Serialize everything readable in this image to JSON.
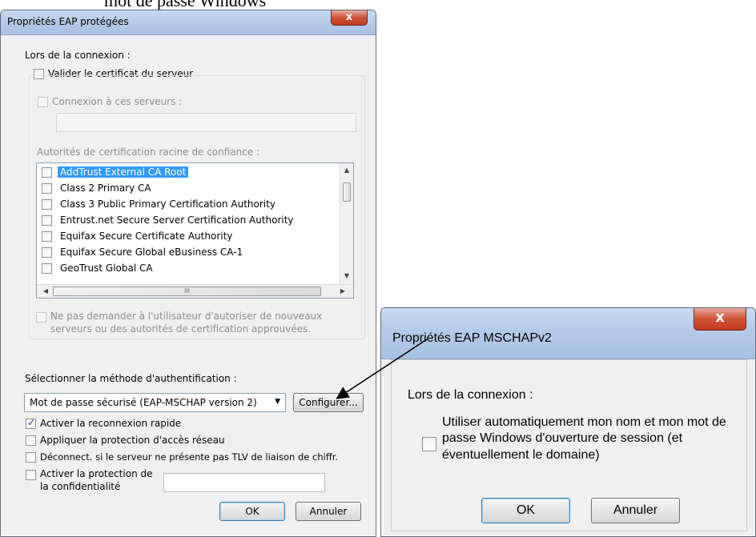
{
  "caption": "mot de passe Windows",
  "eap_dialog": {
    "title": "Propriétés EAP protégées",
    "on_connect_label": "Lors de la connexion :",
    "validate_cert_label": "Valider le certificat du serveur",
    "connect_servers_label": "Connexion à ces serveurs :",
    "servers_value": "",
    "trusted_roots_label": "Autorités de certification racine de confiance :",
    "cert_list": [
      {
        "label": "AddTrust External CA Root",
        "selected": true
      },
      {
        "label": "Class 2 Primary CA",
        "selected": false
      },
      {
        "label": "Class 3 Public Primary Certification Authority",
        "selected": false
      },
      {
        "label": "Entrust.net Secure Server Certification Authority",
        "selected": false
      },
      {
        "label": "Equifax Secure Certificate Authority",
        "selected": false
      },
      {
        "label": "Equifax Secure Global eBusiness CA-1",
        "selected": false
      },
      {
        "label": "GeoTrust Global CA",
        "selected": false
      }
    ],
    "hscroll_thumb_glyph": "III",
    "no_prompt_line1": "Ne pas demander à l'utilisateur d'autoriser de nouveaux",
    "no_prompt_line2": "serveurs ou des autorités de certification approuvées.",
    "auth_method_label": "Sélectionner la méthode d'authentification :",
    "auth_method_value": "Mot de passe sécurisé (EAP-MSCHAP version 2)",
    "configure_label": "Configurer...",
    "fast_reconnect_label": "Activer la reconnexion rapide",
    "nap_label": "Appliquer la protection d'accès réseau",
    "disconnect_tlv_label": "Déconnect. si le serveur ne présente pas TLV de liaison de chiffr.",
    "identity_privacy_line1": "Activer la protection de",
    "identity_privacy_line2": "la confidentialité",
    "identity_value": "",
    "ok_label": "OK",
    "cancel_label": "Annuler",
    "close_glyph": "x"
  },
  "mschap_dialog": {
    "title": "Propriétés EAP MSCHAPv2",
    "on_connect_label": "Lors de la connexion :",
    "auto_logon_line1": "Utiliser automatiquement mon nom et mon mot de",
    "auto_logon_line2": "passe Windows d'ouverture de session (et",
    "auto_logon_line3": "éventuellement le domaine)",
    "ok_label": "OK",
    "cancel_label": "Annuler",
    "close_glyph": "x"
  },
  "colors": {
    "selection": "#3399ff",
    "titlebar": "#b4cbe8",
    "close": "#c23a1f"
  }
}
